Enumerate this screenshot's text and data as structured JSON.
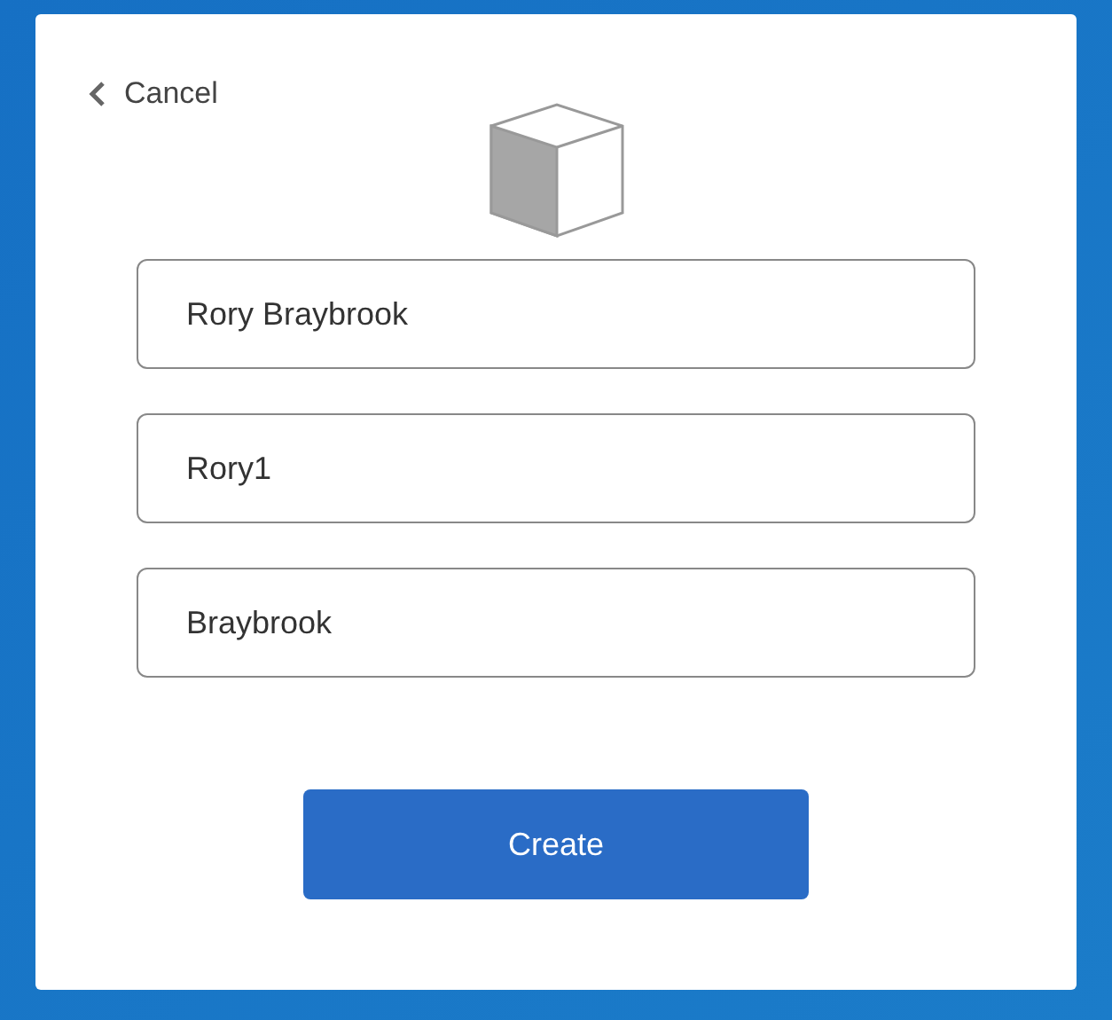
{
  "cancel": {
    "label": "Cancel"
  },
  "fields": [
    {
      "value": "Rory Braybrook"
    },
    {
      "value": "Rory1"
    },
    {
      "value": "Braybrook"
    }
  ],
  "button": {
    "label": "Create"
  }
}
